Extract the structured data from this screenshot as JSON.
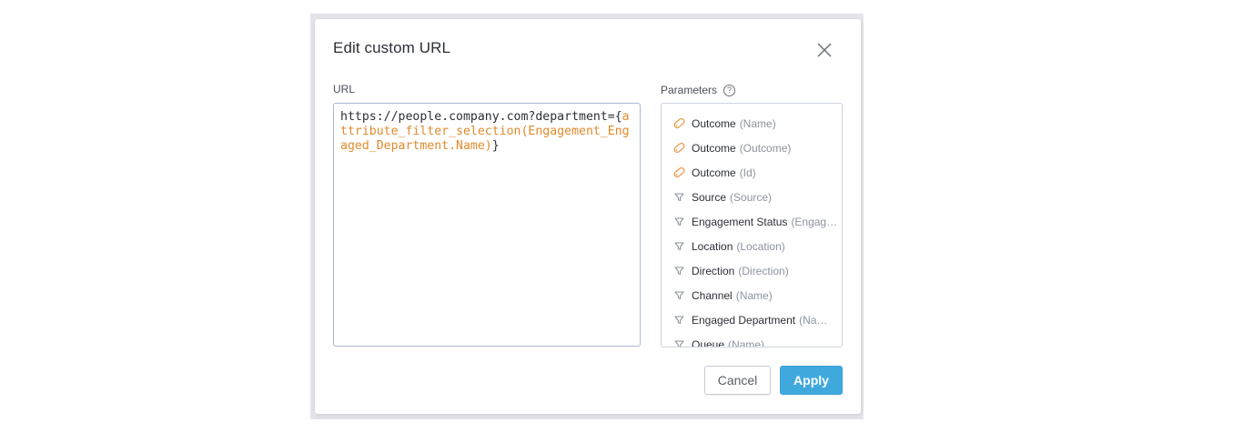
{
  "dialog": {
    "title": "Edit custom URL",
    "url_label": "URL",
    "params_label": "Parameters",
    "help_glyph": "?",
    "url": {
      "plain": "https://people.company.com?department=",
      "open_brace": "{",
      "expression": "attribute_filter_selection(Engagement_Engaged_Department.Name)",
      "close_brace": "}"
    },
    "parameters": [
      {
        "icon": "attribute-label-icon",
        "name": "Outcome",
        "sub": "(Name)"
      },
      {
        "icon": "attribute-label-icon",
        "name": "Outcome",
        "sub": "(Outcome)"
      },
      {
        "icon": "attribute-label-icon",
        "name": "Outcome",
        "sub": "(Id)"
      },
      {
        "icon": "filter-icon",
        "name": "Source",
        "sub": "(Source)"
      },
      {
        "icon": "filter-icon",
        "name": "Engagement Status",
        "sub": "(Engag…"
      },
      {
        "icon": "filter-icon",
        "name": "Location",
        "sub": "(Location)"
      },
      {
        "icon": "filter-icon",
        "name": "Direction",
        "sub": "(Direction)"
      },
      {
        "icon": "filter-icon",
        "name": "Channel",
        "sub": "(Name)"
      },
      {
        "icon": "filter-icon",
        "name": "Engaged Department",
        "sub": "(Na…"
      },
      {
        "icon": "filter-icon",
        "name": "Queue",
        "sub": "(Name)"
      }
    ],
    "cancel_label": "Cancel",
    "apply_label": "Apply"
  },
  "colors": {
    "accent": "#3fa9dd",
    "expression": "#e18a2c",
    "label_icon": "#e8a25a",
    "filter_icon": "#8d939c"
  }
}
